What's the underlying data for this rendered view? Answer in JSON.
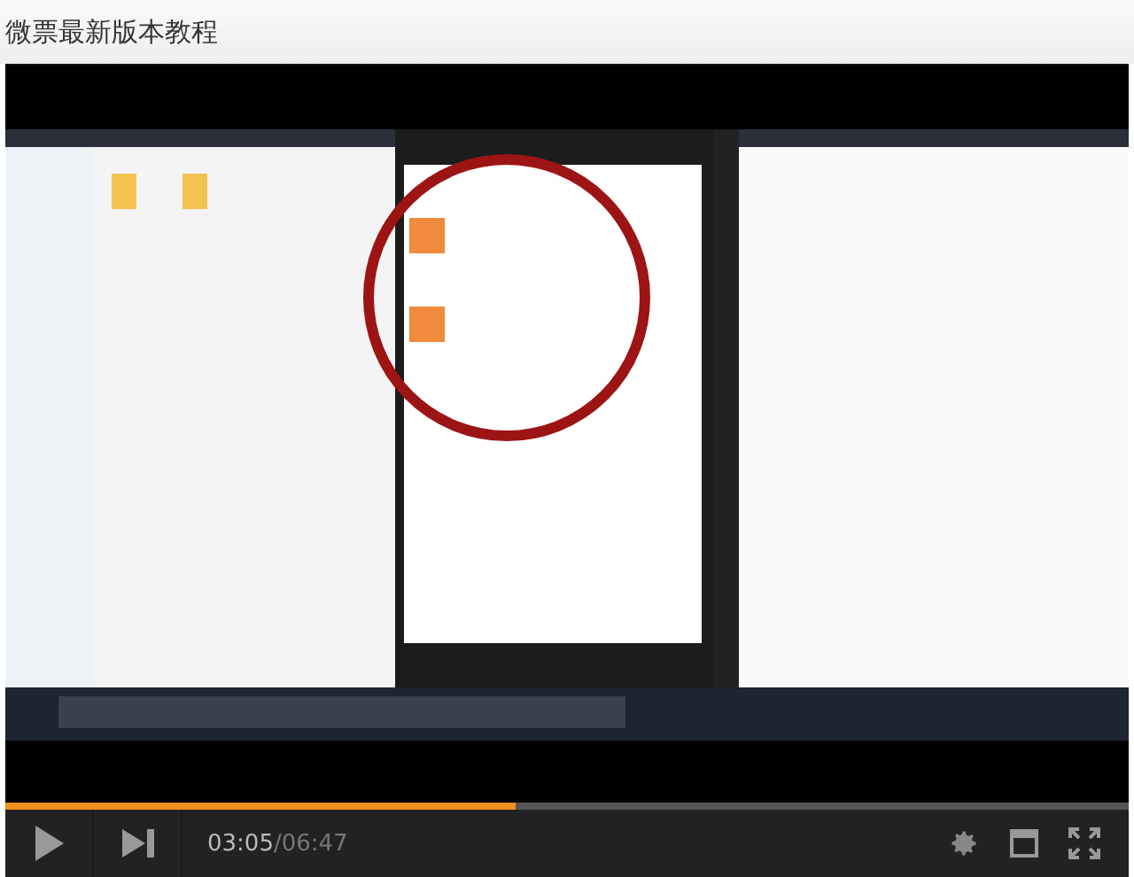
{
  "page": {
    "title": "微票最新版本教程"
  },
  "player": {
    "progress": {
      "level": 0.455
    },
    "time": {
      "current": "03:05",
      "separator": "/",
      "total": "06:47"
    }
  }
}
